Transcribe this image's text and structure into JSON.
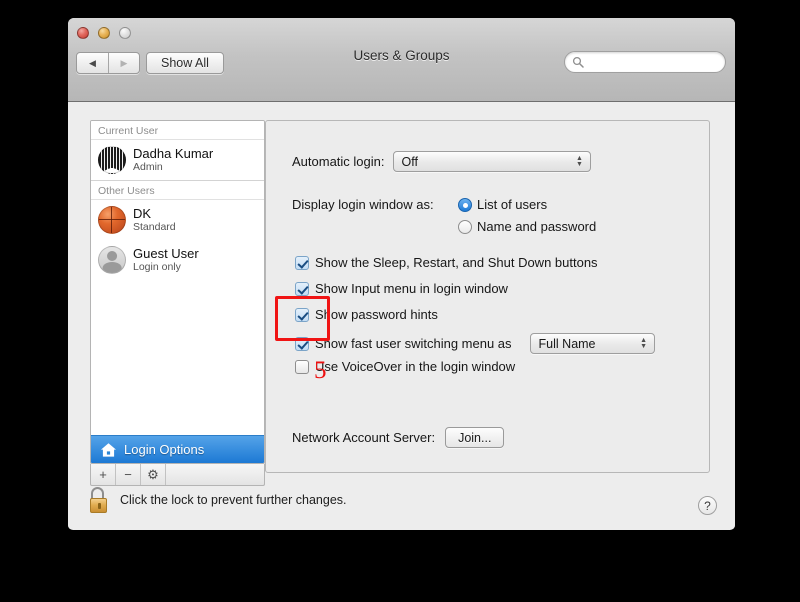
{
  "window": {
    "title": "Users & Groups",
    "traffic_lights": [
      "close",
      "minimize",
      "zoom"
    ]
  },
  "toolbar": {
    "back_label": "◀",
    "forward_label": "▶",
    "show_all_label": "Show All",
    "search_placeholder": "",
    "search_value": ""
  },
  "sidebar": {
    "current_user_header": "Current User",
    "other_users_header": "Other Users",
    "current_user": {
      "name": "Dadha Kumar",
      "role": "Admin",
      "avatar": "piano-avatar"
    },
    "other_users": [
      {
        "name": "DK",
        "role": "Standard",
        "avatar": "basketball-avatar"
      },
      {
        "name": "Guest User",
        "role": "Login only",
        "avatar": "person-avatar"
      }
    ],
    "login_options_label": "Login Options",
    "toolbar_buttons": [
      {
        "name": "add-user-button",
        "label": "+"
      },
      {
        "name": "remove-user-button",
        "label": "−"
      },
      {
        "name": "settings-button",
        "label": "⚙"
      }
    ]
  },
  "main": {
    "automatic_login": {
      "label": "Automatic login:",
      "value": "Off"
    },
    "display_login_window": {
      "label": "Display login window as:",
      "options": [
        {
          "label": "List of users",
          "selected": true
        },
        {
          "label": "Name and password",
          "selected": false
        }
      ]
    },
    "checkboxes": [
      {
        "label": "Show the Sleep, Restart, and Shut Down buttons",
        "checked": true
      },
      {
        "label": "Show password hints",
        "checked": true
      },
      {
        "label": "Show Input menu in login window",
        "checked": true
      },
      {
        "label": "Show fast user switching menu as",
        "checked": true
      },
      {
        "label": "Use VoiceOver in the login window",
        "checked": false
      }
    ],
    "fast_user_switching_format": "Full Name",
    "network_account_server": {
      "label": "Network Account Server:",
      "button_label": "Join..."
    }
  },
  "footer": {
    "lock_text": "Click the lock to prevent further changes.",
    "lock_state": "unlocked",
    "help_label": "?"
  },
  "annotation": {
    "step_number": "5",
    "color": "#ee1111"
  }
}
